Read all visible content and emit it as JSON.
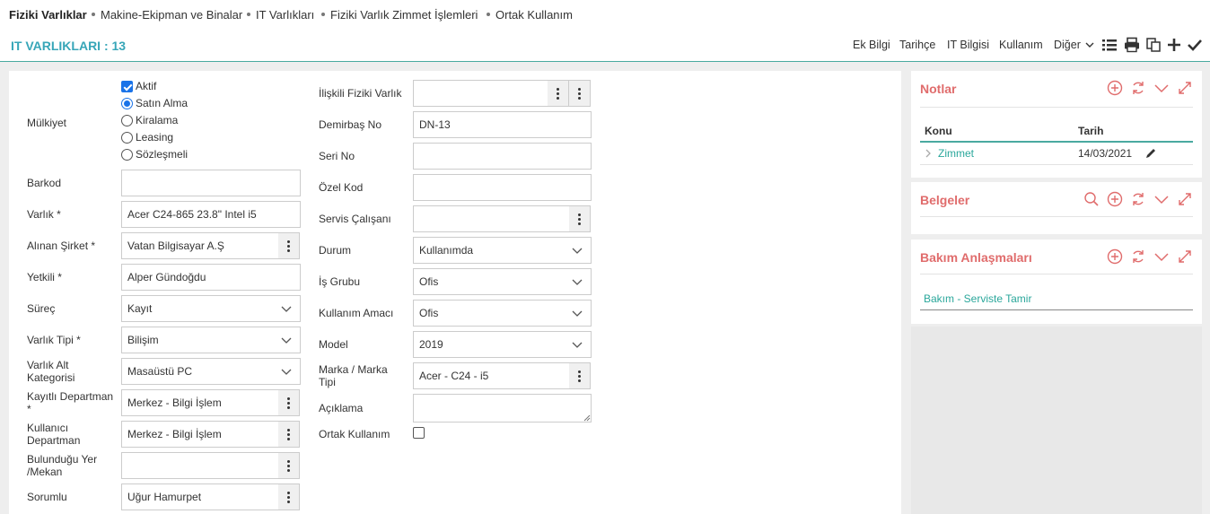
{
  "topnav": {
    "items": [
      "Fiziki Varlıklar",
      "Makine-Ekipman ve Binalar",
      "IT Varlıkları",
      "Fiziki Varlık Zimmet İşlemleri",
      "Ortak Kullanım"
    ]
  },
  "header": {
    "title": "IT VARLIKLARI : 13",
    "links": [
      "Ek Bilgi",
      "Tarihçe",
      "IT Bilgisi",
      "Kullanım",
      "Diğer"
    ],
    "icons": [
      "list-icon",
      "print-icon",
      "copy-icon",
      "plus-icon",
      "check-icon"
    ]
  },
  "form_left": {
    "mulkiyet_label": "Mülkiyet",
    "aktif_label": "Aktif",
    "aktif_checked": true,
    "ownership_options": [
      "Satın Alma",
      "Kiralama",
      "Leasing",
      "Sözleşmeli"
    ],
    "ownership_selected": "Satın Alma",
    "barkod_label": "Barkod",
    "barkod_value": "",
    "varlik_label": "Varlık *",
    "varlik_value": "Acer C24-865 23.8\" Intel i5",
    "alinan_sirket_label": "Alınan Şirket *",
    "alinan_sirket_value": "Vatan Bilgisayar A.Ş",
    "yetkili_label": "Yetkili *",
    "yetkili_value": "Alper Gündoğdu",
    "surec_label": "Süreç",
    "surec_value": "Kayıt",
    "varlik_tipi_label": "Varlık Tipi *",
    "varlik_tipi_value": "Bilişim",
    "varlik_alt_kat_label_1": "Varlık Alt",
    "varlik_alt_kat_label_2": "Kategorisi",
    "varlik_alt_kat_value": "Masaüstü PC",
    "kayitli_dep_label_1": "Kayıtlı Departman",
    "kayitli_dep_label_2": "*",
    "kayitli_dep_value": "Merkez - Bilgi İşlem",
    "kullanici_dep_label_1": "Kullanıcı",
    "kullanici_dep_label_2": "Departman",
    "kullanici_dep_value": "Merkez - Bilgi İşlem",
    "bulundugu_label_1": "Bulunduğu Yer",
    "bulundugu_label_2": "/Mekan",
    "bulundugu_value": "",
    "sorumlu_label": "Sorumlu",
    "sorumlu_value": "Uğur Hamurpet"
  },
  "form_right": {
    "iliskili_label": "İlişkili Fiziki Varlık",
    "iliskili_value": "",
    "demirbas_label": "Demirbaş No",
    "demirbas_value": "DN-13",
    "seri_label": "Seri No",
    "seri_value": "",
    "ozel_kod_label": "Özel Kod",
    "ozel_kod_value": "",
    "servis_label": "Servis Çalışanı",
    "servis_value": "",
    "durum_label": "Durum",
    "durum_value": "Kullanımda",
    "is_grubu_label": "İş Grubu",
    "is_grubu_value": "Ofis",
    "kullanim_amaci_label": "Kullanım Amacı",
    "kullanim_amaci_value": "Ofis",
    "model_label": "Model",
    "model_value": "2019",
    "marka_label_1": "Marka / Marka",
    "marka_label_2": "Tipi",
    "marka_value": "Acer - C24  - i5",
    "aciklama_label": "Açıklama",
    "aciklama_value": "",
    "ortak_label": "Ortak Kullanım",
    "ortak_checked": false
  },
  "notlar": {
    "title": "Notlar",
    "col_konu": "Konu",
    "col_tarih": "Tarih",
    "rows": [
      {
        "konu": "Zimmet",
        "tarih": "14/03/2021"
      }
    ]
  },
  "belgeler": {
    "title": "Belgeler"
  },
  "bakim": {
    "title": "Bakım Anlaşmaları",
    "items": [
      "Bakım - Serviste Tamir"
    ]
  },
  "colors": {
    "accent": "#37a6b8",
    "panel_title": "#e06c6c",
    "link": "#2aa79b"
  }
}
